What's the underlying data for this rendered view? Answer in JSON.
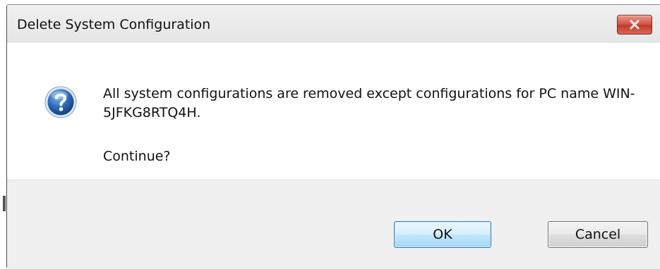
{
  "dialog": {
    "title": "Delete System Configuration",
    "icon": "question-icon",
    "message": "All system configurations are removed except configurations for PC name WIN-5JFKG8RTQ4H.",
    "prompt": "Continue?",
    "close_icon": "close-icon"
  },
  "buttons": {
    "ok_label": "OK",
    "cancel_label": "Cancel"
  },
  "colors": {
    "close_button": "#c4392c",
    "ok_button_border": "#3c7fb1",
    "question_icon": "#1e5fa8"
  }
}
